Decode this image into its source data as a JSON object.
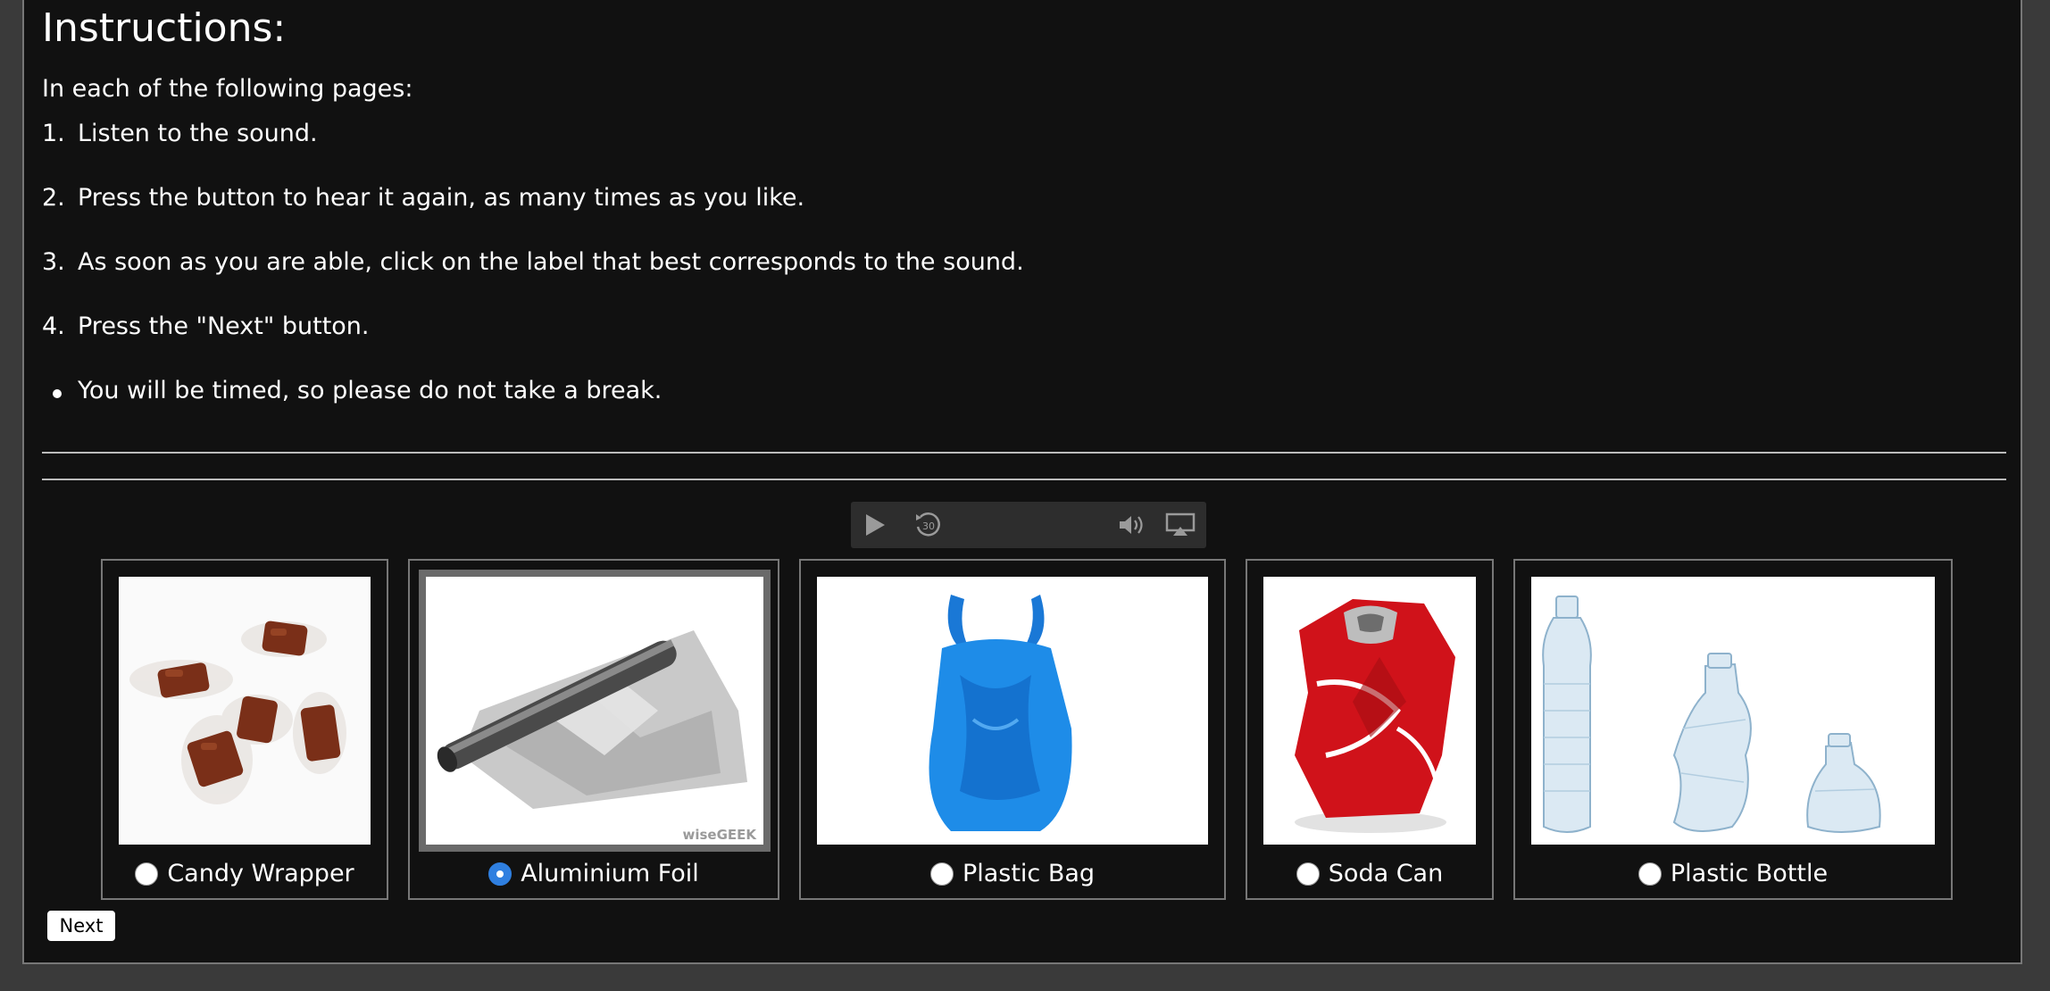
{
  "instructions": {
    "title": "Instructions:",
    "intro": "In each of the following pages:",
    "steps": [
      {
        "num": "1.",
        "text": "Listen to the sound."
      },
      {
        "num": "2.",
        "text": "Press the button to hear it again, as many times as you like."
      },
      {
        "num": "3.",
        "text": "As soon as you are able, click on the label that best corresponds to the sound."
      },
      {
        "num": "4.",
        "text": "Press the \"Next\" button."
      }
    ],
    "note": "You will be timed, so please do not take a break."
  },
  "player": {
    "icons": [
      "play-icon",
      "replay-30-icon",
      "volume-icon",
      "airplay-icon"
    ],
    "replay_seconds": "30"
  },
  "choices": [
    {
      "label": "Candy Wrapper",
      "selected": false,
      "image": "candy-wrapper-image"
    },
    {
      "label": "Aluminium Foil",
      "selected": true,
      "image": "aluminium-foil-image",
      "watermark": "wiseGEEK"
    },
    {
      "label": "Plastic Bag",
      "selected": false,
      "image": "plastic-bag-image"
    },
    {
      "label": "Soda Can",
      "selected": false,
      "image": "soda-can-image"
    },
    {
      "label": "Plastic Bottle",
      "selected": false,
      "image": "plastic-bottle-image"
    }
  ],
  "colors": {
    "background": "#111111",
    "radio_selected": "#2f7fe0",
    "text": "#ffffff"
  },
  "next_label": "Next"
}
